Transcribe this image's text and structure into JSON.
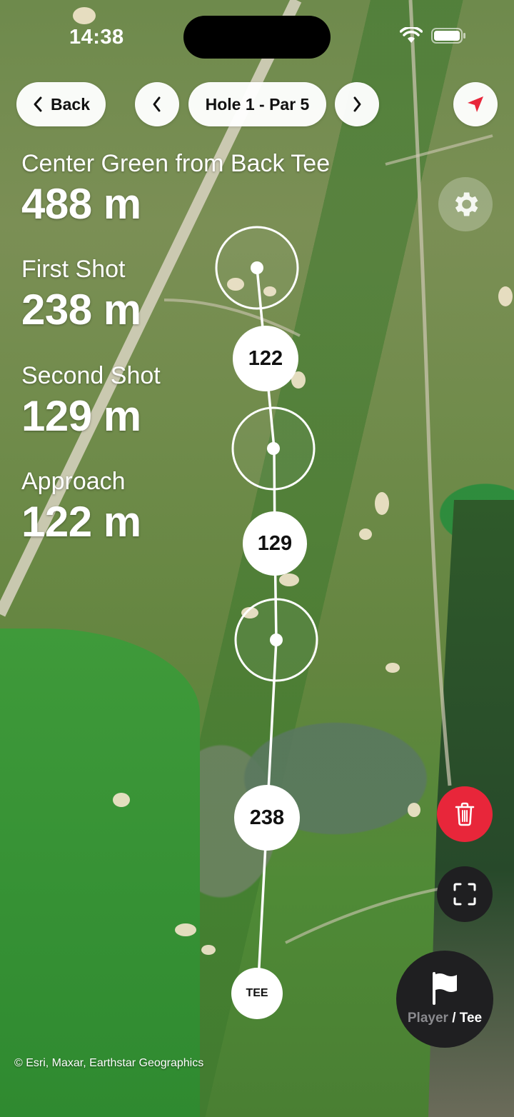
{
  "status_bar": {
    "time": "14:38"
  },
  "nav": {
    "back_label": "Back",
    "hole_label": "Hole 1 - Par 5"
  },
  "distances": [
    {
      "label": "Center Green from Back Tee",
      "value": "488 m"
    },
    {
      "label": "First Shot",
      "value": "238 m"
    },
    {
      "label": "Second Shot",
      "value": "129 m"
    },
    {
      "label": "Approach",
      "value": "122 m"
    }
  ],
  "shot_markers": {
    "segment_labels": [
      "122",
      "129",
      "238"
    ],
    "tee_label": "TEE"
  },
  "controls": {
    "player_label": "Player",
    "separator": "/",
    "tee_label": "Tee"
  },
  "attribution": "© Esri, Maxar, Earthstar Geographics",
  "colors": {
    "accent_red": "#e8263a",
    "dark_button": "#1f1f21"
  },
  "icons": [
    "back-chevron-icon",
    "prev-hole-icon",
    "next-hole-icon",
    "location-arrow-icon",
    "gear-icon",
    "trash-icon",
    "expand-icon",
    "flag-icon",
    "wifi-icon",
    "battery-icon"
  ]
}
